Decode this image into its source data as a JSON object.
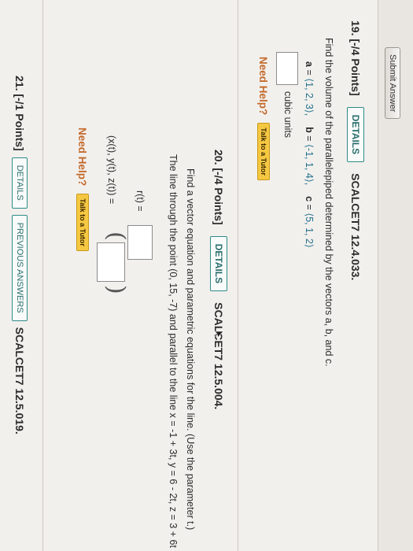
{
  "toolbar": {
    "submit_label": "Submit Answer"
  },
  "q19": {
    "title": "19. [-/4 Points]",
    "details_label": "DETAILS",
    "code": "SCALCET7 12.4.033.",
    "prompt": "Find the volume of the parallelepiped determined by the vectors a, b, and c.",
    "vec_a_name": "a",
    "vec_a_value": "⟨1, 2, 3⟩,",
    "vec_b_name": "b",
    "vec_b_value": "⟨-1, 1, 4⟩,",
    "vec_c_name": "c",
    "vec_c_value": "⟨5, 1, 2⟩",
    "equals": "=",
    "units": "cubic units",
    "need_help": "Need Help?",
    "tutor_label": "Talk to a Tutor"
  },
  "q20": {
    "title": "20. [-/4 Points]",
    "details_label": "DETAILS",
    "code": "SCALCET7 12.5.004.",
    "prompt": "Find a vector equation and parametric equations for the line. (Use the parameter t.)",
    "subprompt": "The line through the point (0, 15, -7) and parallel to the line x = -1 + 3t, y = 6 - 2t, z = 3 + 6t",
    "r_label": "r(t) =",
    "xyz_label": "(x(t), y(t), z(t)) =",
    "open_paren": "(",
    "close_paren": ")",
    "need_help": "Need Help?",
    "tutor_label": "Talk to a Tutor"
  },
  "q21": {
    "title": "21. [-/1 Points]",
    "details_label": "DETAILS",
    "previous_answers_label": "PREVIOUS ANSWERS",
    "code": "SCALCET7 12.5.019."
  },
  "colors": {
    "accent_teal": "#2e8b88",
    "need_help_orange": "#c36a2d",
    "tutor_yellow": "#f6c842"
  }
}
